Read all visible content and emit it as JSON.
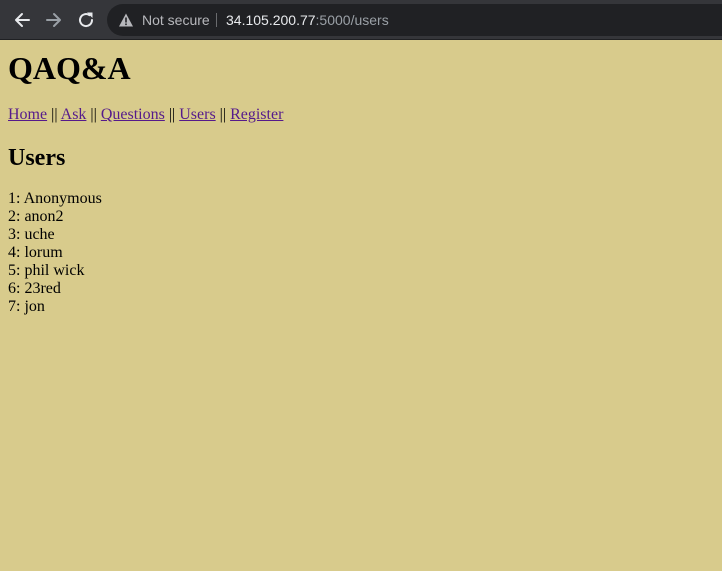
{
  "browser": {
    "security_label": "Not secure",
    "url_host": "34.105.200.77",
    "url_rest": ":5000/users",
    "icons": {
      "back": "arrow-left-icon",
      "forward": "arrow-right-icon",
      "reload": "reload-icon",
      "security": "warning-triangle-icon"
    },
    "colors": {
      "toolbar": "#35363a",
      "omnibox": "#202124"
    }
  },
  "page": {
    "background": "#d8cb8c",
    "site_title": "QAQ&A",
    "nav": {
      "home": "Home",
      "ask": "Ask",
      "questions": "Questions",
      "users": "Users",
      "register": "Register",
      "separator": "||"
    },
    "section_title": "Users",
    "users": [
      "1: Anonymous",
      "2: anon2",
      "3: uche",
      "4: lorum",
      "5: phil wick",
      "6: 23red",
      "7: jon"
    ]
  }
}
